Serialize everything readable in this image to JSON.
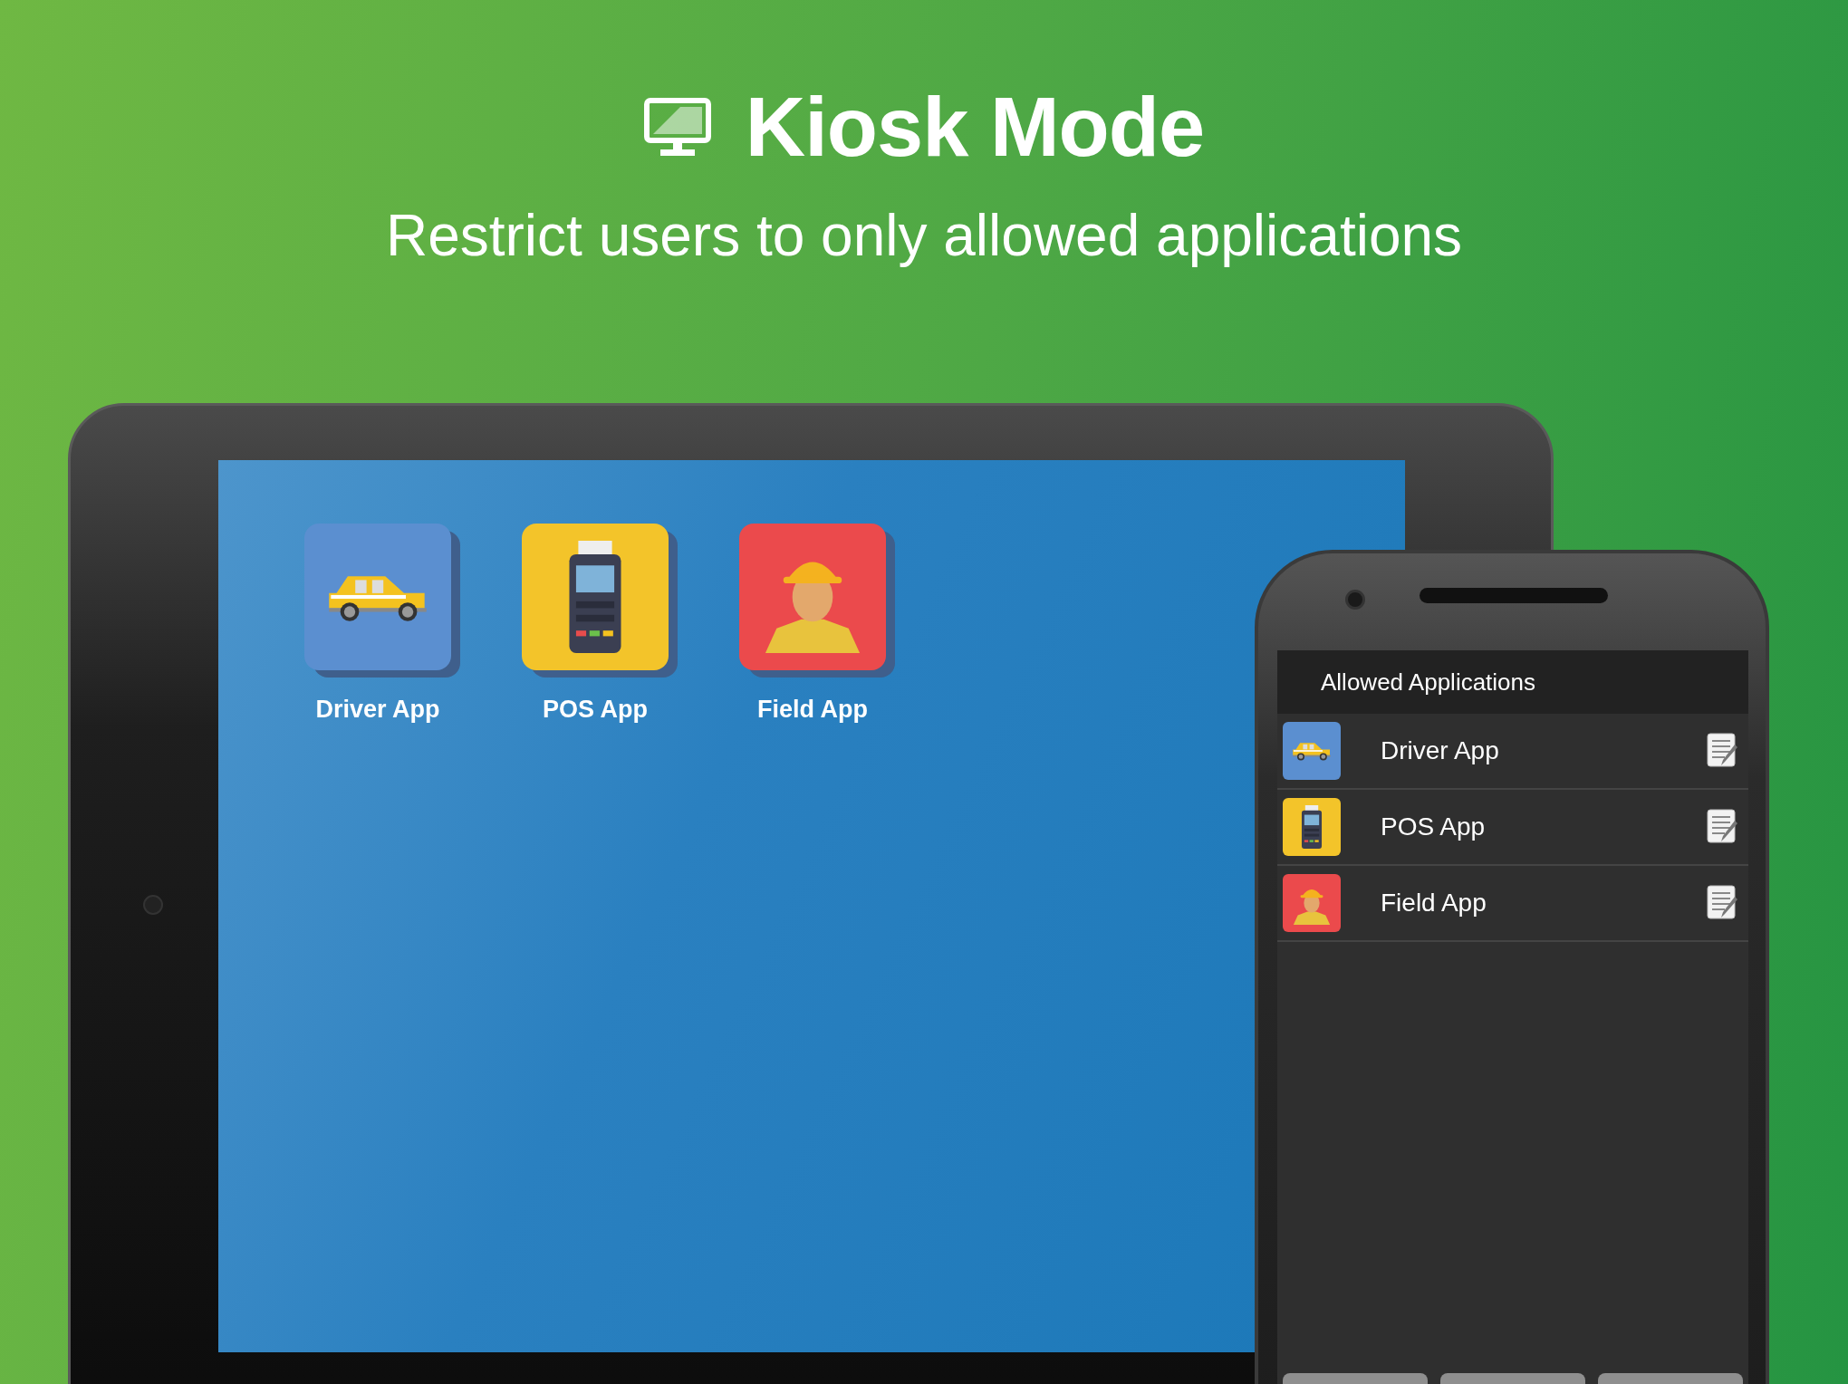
{
  "header": {
    "title": "Kiosk Mode",
    "subtitle": "Restrict users to only allowed applications"
  },
  "tablet": {
    "apps": [
      {
        "label": "Driver App",
        "kind": "taxi",
        "color": "#5b8fd0"
      },
      {
        "label": "POS App",
        "kind": "pos",
        "color": "#f3c42a"
      },
      {
        "label": "Field App",
        "kind": "worker",
        "color": "#eb4a4c"
      }
    ]
  },
  "phone": {
    "title": "Allowed Applications",
    "apps": [
      {
        "label": "Driver App",
        "kind": "taxi",
        "color": "#5b8fd0"
      },
      {
        "label": "POS App",
        "kind": "pos",
        "color": "#f3c42a"
      },
      {
        "label": "Field App",
        "kind": "worker",
        "color": "#eb4a4c"
      }
    ]
  }
}
